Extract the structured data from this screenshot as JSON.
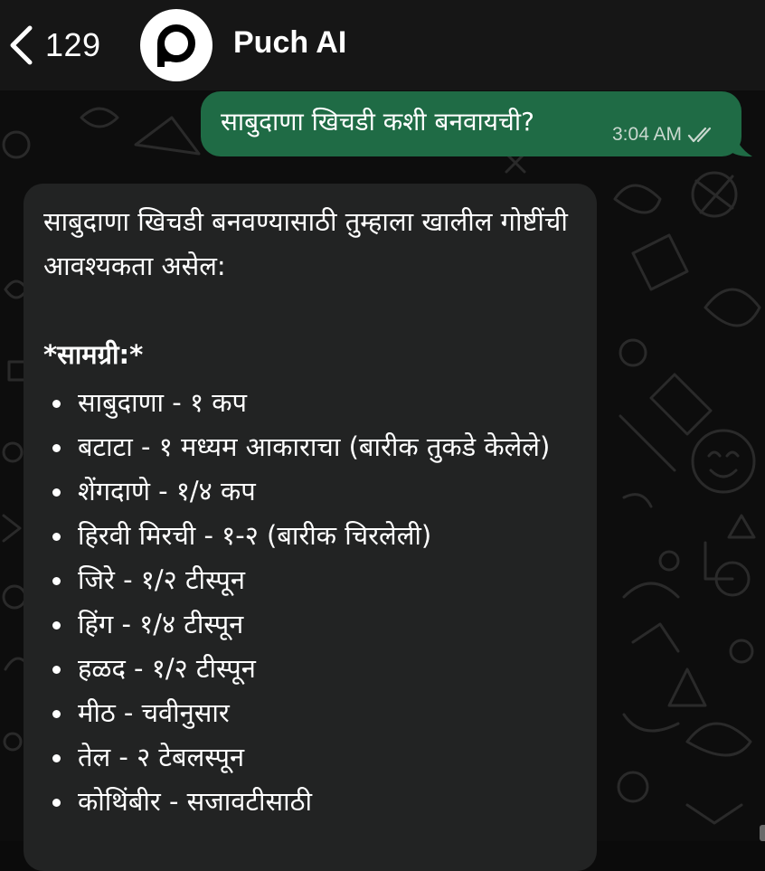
{
  "header": {
    "back_icon": "chevron-left-icon",
    "unread_count": "129",
    "contact_name": "Puch AI",
    "avatar_icon": "puch-logo-icon"
  },
  "messages": {
    "outgoing": {
      "text": "साबुदाणा खिचडी कशी बनवायची?",
      "time": "3:04 AM",
      "status_icon": "double-check-icon"
    },
    "incoming": {
      "intro": "साबुदाणा खिचडी बनवण्यासाठी तुम्हाला खालील गोष्टींची आवश्यकता असेल:",
      "heading": "*सामग्री:*",
      "items": [
        "साबुदाणा - १ कप",
        "बटाटा - १ मध्यम आकाराचा (बारीक तुकडे केलेले)",
        "शेंगदाणे - १/४ कप",
        "हिरवी मिरची - १-२ (बारीक चिरलेली)",
        "जिरे - १/२ टीस्पून",
        "हिंग - १/४ टीस्पून",
        "हळद - १/२ टीस्पून",
        "मीठ - चवीनुसार",
        "तेल - २ टेबलस्पून",
        "कोथिंबीर - सजावटीसाठी"
      ]
    }
  },
  "colors": {
    "header_bg": "#161616",
    "chat_bg": "#0d0d0d",
    "outgoing_bubble": "#1f6b45",
    "incoming_bubble": "#222323",
    "text": "#ffffff",
    "meta_text": "#c9d8cf"
  }
}
